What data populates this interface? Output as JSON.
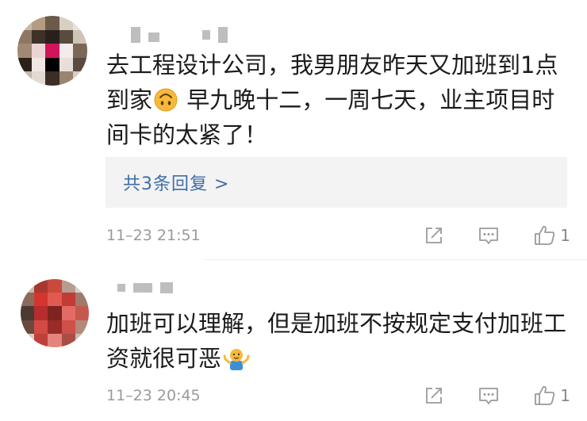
{
  "comments": [
    {
      "username": "",
      "text": "去工程设计公司，我男朋友昨天又加班到1点\n到家",
      "text_after_emoji": " 早九晚十二，一周七天，业主项目时\n间卡的太紧了！",
      "emoji": "upside-down-face-emoji",
      "replies_label": "共3条回复 >",
      "timestamp": "11–23 21:51",
      "like_count": "1"
    },
    {
      "username": "",
      "text": "加班可以理解，但是加班不按规定支付加班工\n资就很可恶",
      "emoji": "shrug-emoji",
      "timestamp": "11–23 20:45",
      "like_count": "1"
    }
  ],
  "colors": {
    "link": "#3f6ea7",
    "meta": "#9a9a9a",
    "reply_bg": "#f3f3f3",
    "emoji_yellow": "#f6b93b"
  },
  "icons": [
    "share-icon",
    "comment-icon",
    "like-icon"
  ]
}
